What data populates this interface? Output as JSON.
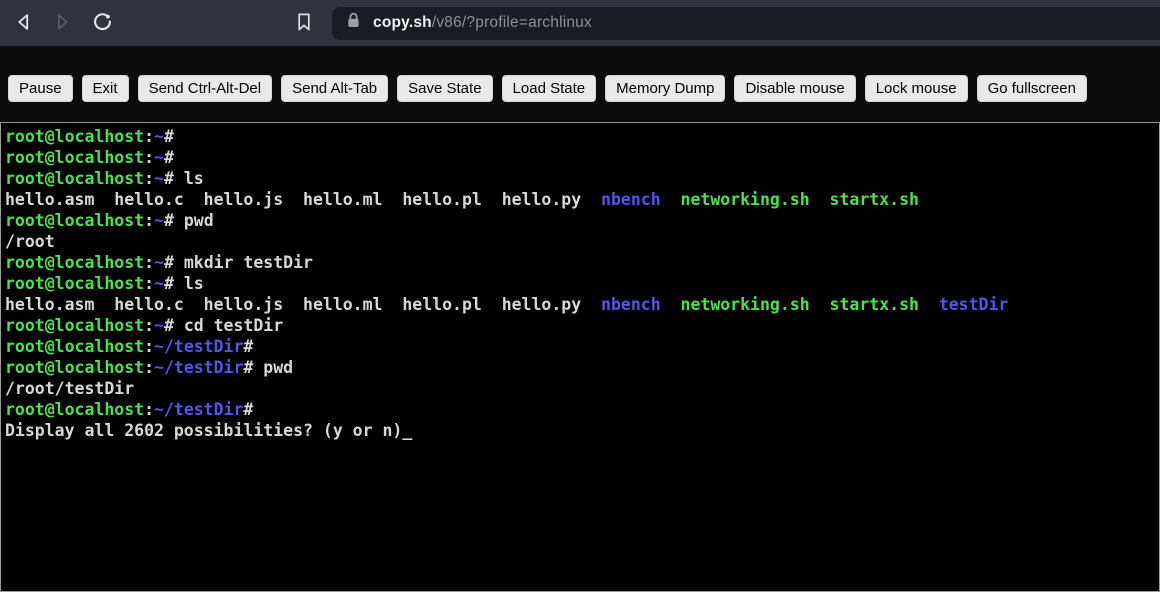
{
  "browser": {
    "url_domain": "copy.sh",
    "url_path": "/v86/?profile=archlinux"
  },
  "controls": {
    "buttons": [
      {
        "id": "pause",
        "label": "Pause"
      },
      {
        "id": "exit",
        "label": "Exit"
      },
      {
        "id": "send-ctrl-alt-del",
        "label": "Send Ctrl-Alt-Del"
      },
      {
        "id": "send-alt-tab",
        "label": "Send Alt-Tab"
      },
      {
        "id": "save-state",
        "label": "Save State"
      },
      {
        "id": "load-state",
        "label": "Load State"
      },
      {
        "id": "memory-dump",
        "label": "Memory Dump"
      },
      {
        "id": "disable-mouse",
        "label": "Disable mouse"
      },
      {
        "id": "lock-mouse",
        "label": "Lock mouse"
      },
      {
        "id": "go-fullscreen",
        "label": "Go fullscreen"
      }
    ]
  },
  "colors": {
    "g": "#4be34b",
    "b": "#5356ea",
    "w": "#d8d8d8",
    "toolbar_bg": "#30323d",
    "urlbar_bg": "#1a1c24",
    "terminal_bg": "#000000",
    "button_bg": "#e9e9e9"
  },
  "terminal": {
    "lines": [
      [
        [
          "g",
          "root@localhost"
        ],
        [
          "w",
          ":"
        ],
        [
          "b",
          "~"
        ],
        [
          "w",
          "#"
        ]
      ],
      [
        [
          "g",
          "root@localhost"
        ],
        [
          "w",
          ":"
        ],
        [
          "b",
          "~"
        ],
        [
          "w",
          "#"
        ]
      ],
      [
        [
          "g",
          "root@localhost"
        ],
        [
          "w",
          ":"
        ],
        [
          "b",
          "~"
        ],
        [
          "w",
          "# ls"
        ]
      ],
      [
        [
          "w",
          "hello.asm  hello.c  hello.js  hello.ml  hello.pl  hello.py  "
        ],
        [
          "b",
          "nbench"
        ],
        [
          "w",
          "  "
        ],
        [
          "g",
          "networking.sh"
        ],
        [
          "w",
          "  "
        ],
        [
          "g",
          "startx.sh"
        ]
      ],
      [
        [
          "g",
          "root@localhost"
        ],
        [
          "w",
          ":"
        ],
        [
          "b",
          "~"
        ],
        [
          "w",
          "# pwd"
        ]
      ],
      [
        [
          "w",
          "/root"
        ]
      ],
      [
        [
          "g",
          "root@localhost"
        ],
        [
          "w",
          ":"
        ],
        [
          "b",
          "~"
        ],
        [
          "w",
          "# mkdir testDir"
        ]
      ],
      [
        [
          "g",
          "root@localhost"
        ],
        [
          "w",
          ":"
        ],
        [
          "b",
          "~"
        ],
        [
          "w",
          "# ls"
        ]
      ],
      [
        [
          "w",
          "hello.asm  hello.c  hello.js  hello.ml  hello.pl  hello.py  "
        ],
        [
          "b",
          "nbench"
        ],
        [
          "w",
          "  "
        ],
        [
          "g",
          "networking.sh"
        ],
        [
          "w",
          "  "
        ],
        [
          "g",
          "startx.sh"
        ],
        [
          "w",
          "  "
        ],
        [
          "b",
          "testDir"
        ]
      ],
      [
        [
          "g",
          "root@localhost"
        ],
        [
          "w",
          ":"
        ],
        [
          "b",
          "~"
        ],
        [
          "w",
          "# cd testDir"
        ]
      ],
      [
        [
          "g",
          "root@localhost"
        ],
        [
          "w",
          ":"
        ],
        [
          "b",
          "~/testDir"
        ],
        [
          "w",
          "#"
        ]
      ],
      [
        [
          "g",
          "root@localhost"
        ],
        [
          "w",
          ":"
        ],
        [
          "b",
          "~/testDir"
        ],
        [
          "w",
          "# pwd"
        ]
      ],
      [
        [
          "w",
          "/root/testDir"
        ]
      ],
      [
        [
          "g",
          "root@localhost"
        ],
        [
          "w",
          ":"
        ],
        [
          "b",
          "~/testDir"
        ],
        [
          "w",
          "#"
        ]
      ],
      [
        [
          "w",
          "Display all 2602 possibilities? (y or n)_"
        ]
      ]
    ]
  }
}
